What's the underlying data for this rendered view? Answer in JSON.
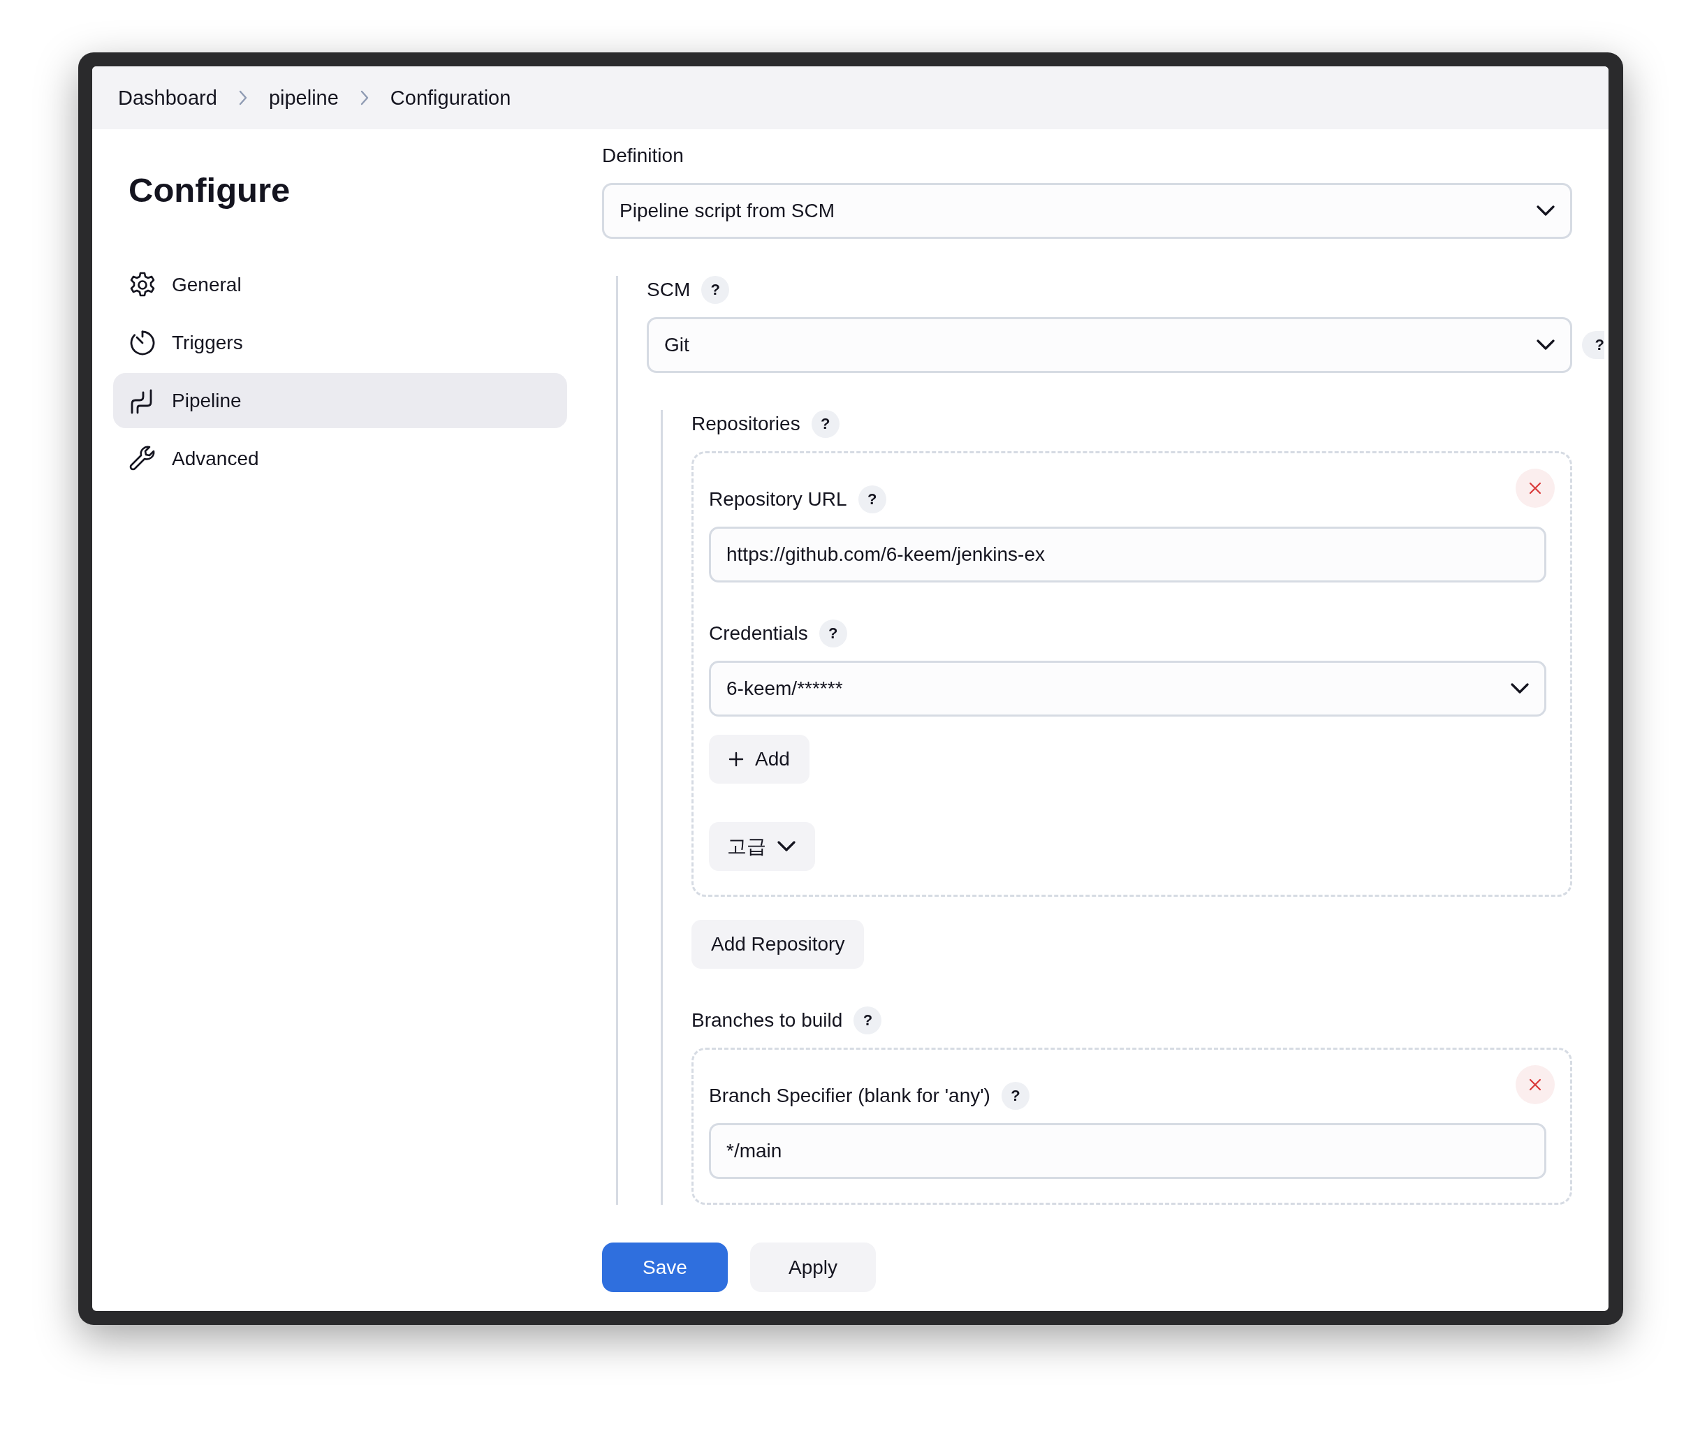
{
  "breadcrumbs": [
    {
      "label": "Dashboard"
    },
    {
      "label": "pipeline"
    },
    {
      "label": "Configuration"
    }
  ],
  "sidebar": {
    "title": "Configure",
    "items": [
      {
        "label": "General",
        "selected": false
      },
      {
        "label": "Triggers",
        "selected": false
      },
      {
        "label": "Pipeline",
        "selected": true
      },
      {
        "label": "Advanced",
        "selected": false
      }
    ]
  },
  "definition": {
    "label": "Definition",
    "value": "Pipeline script from SCM"
  },
  "scm": {
    "label": "SCM",
    "help": "?",
    "value": "Git",
    "side_help": "?",
    "repositories": {
      "label": "Repositories",
      "help": "?",
      "add_button": "Add Repository",
      "items": [
        {
          "url_label": "Repository URL",
          "url_help": "?",
          "url": "https://github.com/6-keem/jenkins-ex",
          "credentials_label": "Credentials",
          "credentials_help": "?",
          "credentials": "6-keem/******",
          "add_button": "Add",
          "advanced_button": "고급"
        }
      ]
    },
    "branches": {
      "label": "Branches to build",
      "help": "?",
      "items": [
        {
          "label": "Branch Specifier (blank for 'any')",
          "help": "?",
          "value": "*/main"
        }
      ]
    }
  },
  "actions": [
    {
      "label": "Save",
      "kind": "primary"
    },
    {
      "label": "Apply",
      "kind": "secondary"
    }
  ]
}
